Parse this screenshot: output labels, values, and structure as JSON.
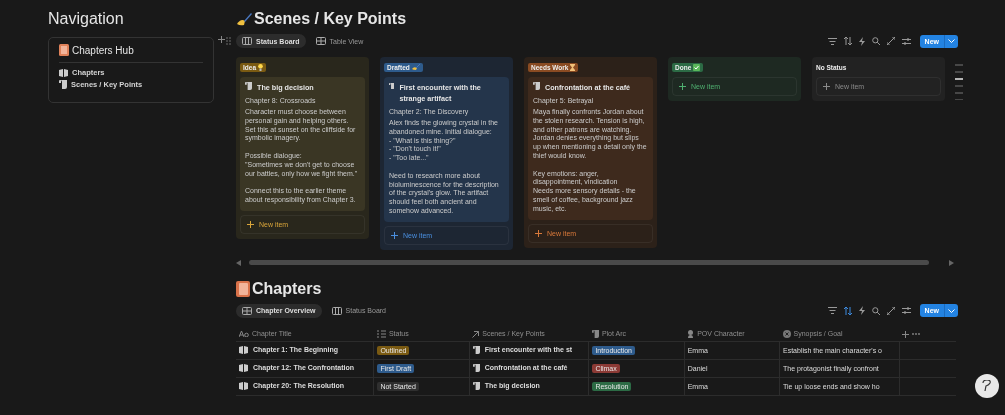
{
  "navigation": {
    "heading": "Navigation",
    "hub_title": "Chapters Hub",
    "links": [
      {
        "label": "Chapters"
      },
      {
        "label": "Scenes / Key Points"
      }
    ]
  },
  "scenes": {
    "title": "Scenes / Key Points",
    "views": [
      {
        "label": "Status Board",
        "kind": "board",
        "selected": true
      },
      {
        "label": "Table View",
        "kind": "table",
        "selected": false
      }
    ],
    "sort_active": false,
    "new_button": "New",
    "columns": [
      {
        "label": "Idea",
        "kind": "idea",
        "color": "#7a5a12",
        "cards": [
          {
            "title": "The big decision",
            "chapter": "Chapter 8: Crossroads",
            "body": "Character must choose between personal gain and helping others. Set this at sunset on the cliffside for symbolic imagery.\n\nPossible dialogue:\n\"Sometimes we don't get to choose our battles, only how we fight them.\"\n\nConnect this to the earlier theme about responsibility from Chapter 3."
          }
        ],
        "new_item": "New item"
      },
      {
        "label": "Drafted",
        "kind": "drafted",
        "color": "#2e5b8c",
        "cards": [
          {
            "title": "First encounter with the strange artifact",
            "chapter": "Chapter 2: The Discovery",
            "body": "Alex finds the glowing crystal in the abandoned mine. Initial dialogue:\n- \"What is this thing?\"\n- \"Don't touch it!\"\n- \"Too late...\"\n\nNeed to research more about bioluminescence for the description of the crystal's glow. The artifact should feel both ancient and somehow advanced."
          }
        ],
        "new_item": "New item"
      },
      {
        "label": "Needs Work",
        "kind": "needswork",
        "color": "#8a4b22",
        "cards": [
          {
            "title": "Confrontation at the café",
            "chapter": "Chapter 5: Betrayal",
            "body": "Maya finally confronts Jordan about the stolen research. Tension is high, and other patrons are watching. Jordan denies everything but slips up when mentioning a detail only the thief would know.\n\nKey emotions: anger, disappointment, vindication\nNeeds more sensory details - the smell of coffee, background jazz music, etc."
          }
        ],
        "new_item": "New item"
      },
      {
        "label": "Done",
        "kind": "done",
        "color": "#2c6b45",
        "new_item": "New item"
      },
      {
        "label": "No Status",
        "kind": "nostatus",
        "new_item": "New item"
      }
    ]
  },
  "chapters": {
    "title": "Chapters",
    "views": [
      {
        "label": "Chapter Overview",
        "kind": "table",
        "selected": true
      },
      {
        "label": "Status Board",
        "kind": "board",
        "selected": false
      }
    ],
    "sort_active": true,
    "new_button": "New",
    "columns": [
      {
        "label": "Chapter Title"
      },
      {
        "label": "Status"
      },
      {
        "label": "Scenes / Key Points"
      },
      {
        "label": "Plot Arc"
      },
      {
        "label": "POV Character"
      },
      {
        "label": "Synopsis / Goal"
      }
    ],
    "rows": [
      {
        "title": "Chapter 1: The Beginning",
        "status": {
          "label": "Outlined",
          "color": "#7a5a12"
        },
        "scene": "First encounter with the st",
        "plot_arc": {
          "label": "Introduction",
          "color": "#2e5b8c"
        },
        "pov": "Emma",
        "synopsis": "Establish the main character's o"
      },
      {
        "title": "Chapter 12: The Confrontation",
        "status": {
          "label": "First Draft",
          "color": "#2e5b8c"
        },
        "scene": "Confrontation at the café",
        "plot_arc": {
          "label": "Climax",
          "color": "#8c3a35"
        },
        "pov": "Daniel",
        "synopsis": "The protagonist finally confront"
      },
      {
        "title": "Chapter 20: The Resolution",
        "status": {
          "label": "Not Started",
          "color": "#2f2f2f"
        },
        "scene": "The big decision",
        "plot_arc": {
          "label": "Resolution",
          "color": "#2c6b45"
        },
        "pov": "Emma",
        "synopsis": "Tie up loose ends and show ho"
      }
    ]
  }
}
